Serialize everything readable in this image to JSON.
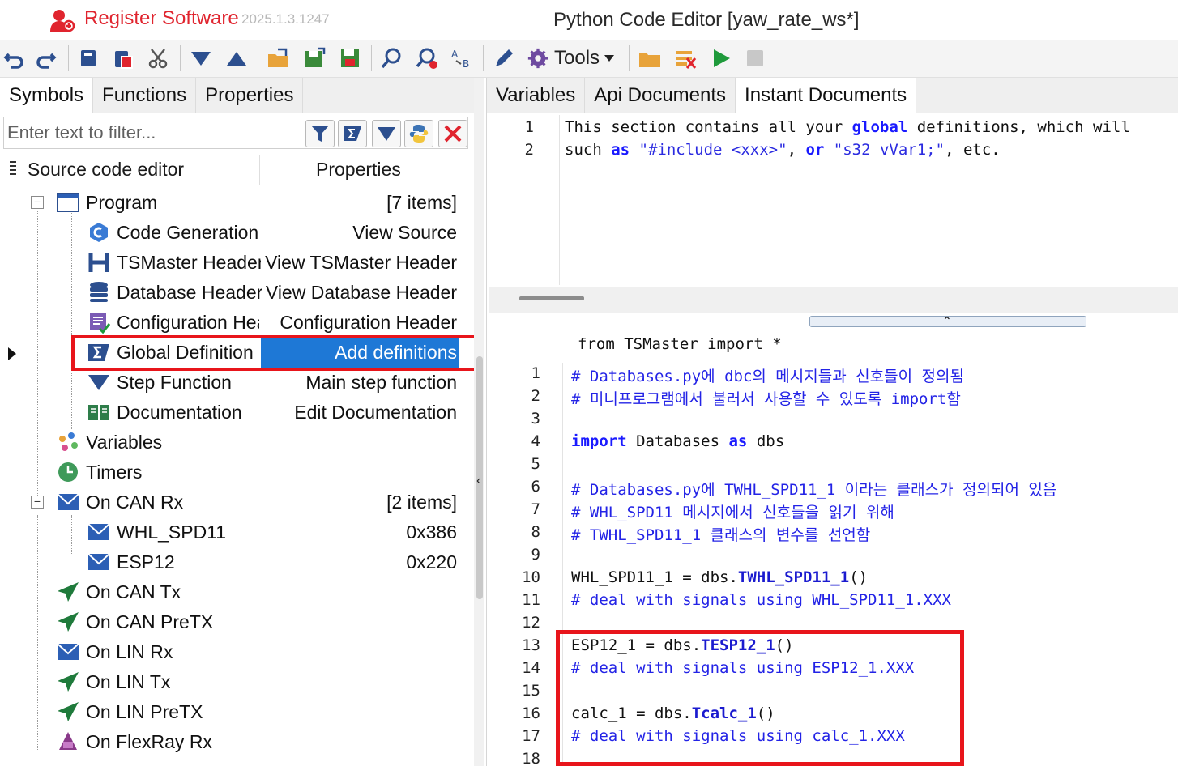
{
  "titlebar": {
    "register_label": "Register Software",
    "version": "2025.1.3.1247",
    "window_title": "Python Code Editor [yaw_rate_ws*]"
  },
  "toolbar": {
    "tools_label": "Tools",
    "icons": [
      "undo-icon",
      "redo-icon",
      "copy-icon",
      "paste-icon",
      "cut-icon",
      "move-down-icon",
      "move-up-icon",
      "open-folder-icon",
      "export-icon",
      "save-icon",
      "find-icon",
      "find-replace-icon",
      "replace-text-icon",
      "edit-icon",
      "gear-icon",
      "folder-icon",
      "clear-icon",
      "run-icon",
      "stop-icon"
    ]
  },
  "left_panel": {
    "tabs": [
      "Symbols",
      "Functions",
      "Properties"
    ],
    "filter_placeholder": "Enter text to filter...",
    "header": {
      "col1": "Source code editor",
      "col2": "Properties"
    },
    "tree": [
      {
        "label": "Program",
        "value": "[7 items]"
      },
      {
        "label": "Code Generation",
        "value": "View Source"
      },
      {
        "label": "TSMaster Header",
        "value": "View TSMaster Header"
      },
      {
        "label": "Database Header",
        "value": "View Database Header"
      },
      {
        "label": "Configuration Header",
        "value": "Configuration Header"
      },
      {
        "label": "Global Definition",
        "value": "Add definitions"
      },
      {
        "label": "Step Function",
        "value": "Main step function"
      },
      {
        "label": "Documentation",
        "value": "Edit Documentation"
      },
      {
        "label": "Variables",
        "value": ""
      },
      {
        "label": "Timers",
        "value": ""
      },
      {
        "label": "On CAN Rx",
        "value": "[2 items]"
      },
      {
        "label": "WHL_SPD11",
        "value": "0x386"
      },
      {
        "label": "ESP12",
        "value": "0x220"
      },
      {
        "label": "On CAN Tx",
        "value": ""
      },
      {
        "label": "On CAN PreTX",
        "value": ""
      },
      {
        "label": "On LIN Rx",
        "value": ""
      },
      {
        "label": "On LIN Tx",
        "value": ""
      },
      {
        "label": "On LIN PreTX",
        "value": ""
      },
      {
        "label": "On FlexRay Rx",
        "value": ""
      }
    ]
  },
  "right_panel": {
    "tabs": [
      "Variables",
      "Api Documents",
      "Instant Documents"
    ],
    "instant_doc": {
      "line_numbers": [
        "1",
        "2"
      ],
      "line1": {
        "a": "This section contains all your ",
        "kw": "global",
        "b": " definitions, which will"
      },
      "line2": {
        "a": "such ",
        "kw1": "as",
        "s1": " \"#include <xxx>\"",
        "comma": ", ",
        "kw2": "or",
        "s2": " \"s32 vVar1;\"",
        "b": ", etc."
      }
    },
    "import_line": "from TSMaster import *",
    "code": {
      "line_numbers": [
        "1",
        "2",
        "3",
        "4",
        "5",
        "6",
        "7",
        "8",
        "9",
        "10",
        "11",
        "12",
        "13",
        "14",
        "15",
        "16",
        "17",
        "18"
      ],
      "c1": "# Databases.py에 dbc의 메시지들과 신호들이 정의됨",
      "c2": "# 미니프로그램에서 불러서 사용할 수 있도록 import함",
      "l4_kw": "import",
      "l4_mid": " Databases ",
      "l4_kw2": "as",
      "l4_end": " dbs",
      "c6": "# Databases.py에 TWHL_SPD11_1 이라는 클래스가 정의되어 있음",
      "c7": "# WHL_SPD11 메시지에서 신호들을 읽기 위해",
      "c8": "# TWHL_SPD11_1 클래스의 변수를 선언함",
      "l10_a": "WHL_SPD11_1 = dbs.",
      "l10_fn": "TWHL_SPD11_1",
      "l10_b": "()",
      "c11": "# deal with signals using WHL_SPD11_1.XXX",
      "l13_a": "ESP12_1 = dbs.",
      "l13_fn": "TESP12_1",
      "l13_b": "()",
      "c14": "# deal with signals using ESP12_1.XXX",
      "l16_a": "calc_1 = dbs.",
      "l16_fn": "Tcalc_1",
      "l16_b": "()",
      "c17": "# deal with signals using calc_1.XXX"
    }
  },
  "colors": {
    "brand_red": "#e0242e",
    "selection_blue": "#1e78d6",
    "highlight_red": "#e8151b",
    "keyword_blue": "#1a1aff"
  }
}
